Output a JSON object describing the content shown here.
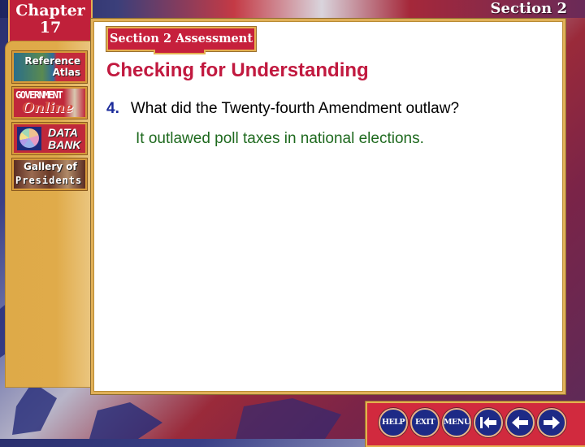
{
  "header": {
    "chapter_label": "Chapter",
    "chapter_number": "17",
    "section_label": "Section 2",
    "assessment_badge": "Section 2 Assessment"
  },
  "sidebar": {
    "items": [
      {
        "id": "reference-atlas",
        "line1": "Reference",
        "line2": "Atlas"
      },
      {
        "id": "government-online",
        "line1": "GOVERNMENT",
        "line2": "Online"
      },
      {
        "id": "data-bank",
        "line1": "DATA",
        "line2": "BANK",
        "icon": "pie-chart-icon"
      },
      {
        "id": "gallery-of-presidents",
        "line1": "Gallery of",
        "line2": "Presidents"
      }
    ]
  },
  "main": {
    "heading": "Checking for Understanding",
    "question_number": "4.",
    "question": "What did the Twenty-fourth Amendment outlaw?",
    "answer": "It outlawed poll taxes in national elections."
  },
  "navbar": {
    "buttons": [
      {
        "label": "HELP",
        "icon": "help-icon"
      },
      {
        "label": "EXIT",
        "icon": "exit-icon"
      },
      {
        "label": "MENU",
        "icon": "menu-icon"
      },
      {
        "label": "",
        "icon": "first-slide-icon"
      },
      {
        "label": "",
        "icon": "previous-slide-icon"
      },
      {
        "label": "",
        "icon": "next-slide-icon"
      }
    ]
  },
  "colors": {
    "heading": "#c1193f",
    "question_number": "#1a2a9a",
    "answer": "#1f6a1f",
    "badge_red": "#c6203c",
    "gold_border": "#e5b050",
    "nav_button_blue": "#1d2a86"
  }
}
